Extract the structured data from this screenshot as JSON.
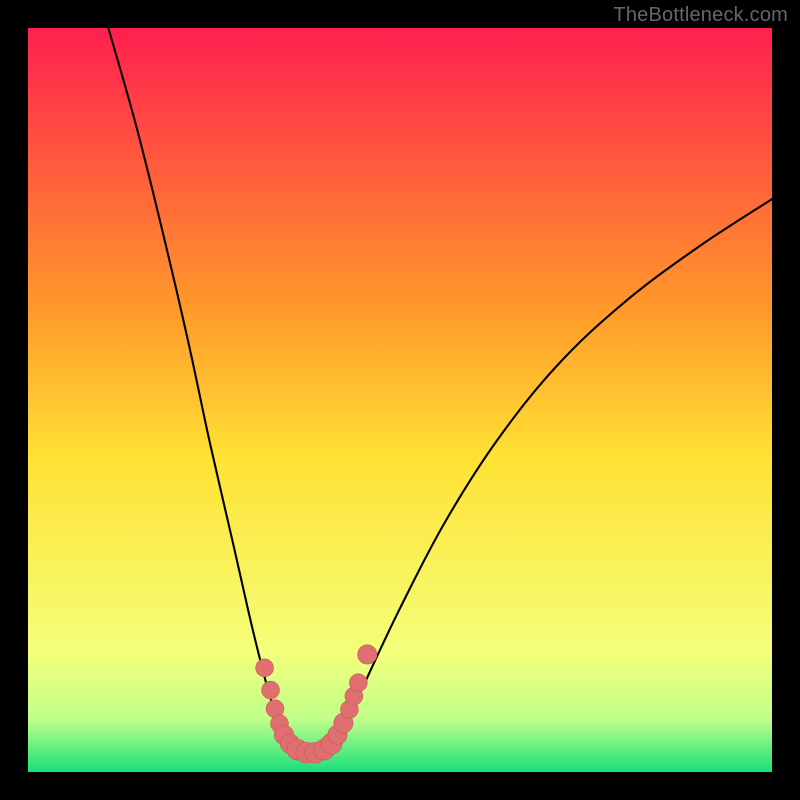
{
  "watermark": "TheBottleneck.com",
  "colors": {
    "frame": "#000000",
    "grad_top": "#ff1f4f",
    "grad_mid_high": "#ff9a2a",
    "grad_mid": "#ffe234",
    "grad_low": "#f4ff7a",
    "grad_band": "#bfff8a",
    "grad_bottom": "#18e07a",
    "curve": "#000000",
    "marker_fill": "#e06f6f",
    "marker_stroke": "#c85a5a"
  },
  "chart_data": {
    "type": "line",
    "title": "",
    "xlabel": "",
    "ylabel": "",
    "xlim": [
      0,
      100
    ],
    "ylim": [
      0,
      100
    ],
    "left_curve": {
      "x": [
        10.8,
        14.5,
        18.0,
        21.5,
        24.5,
        27.5,
        30.0,
        32.0,
        33.5,
        34.5,
        35.3
      ],
      "y": [
        100,
        87,
        73,
        58,
        44,
        31,
        20,
        12,
        7,
        4,
        2.5
      ]
    },
    "right_curve": {
      "x": [
        40.5,
        42.5,
        45.5,
        50.0,
        56.0,
        63.0,
        71.0,
        80.0,
        90.0,
        100.0
      ],
      "y": [
        2.6,
        6.0,
        12.5,
        22.0,
        33.5,
        44.5,
        54.5,
        63.0,
        70.5,
        77.0
      ]
    },
    "valley_floor": {
      "x": [
        35.3,
        36.5,
        37.8,
        39.0,
        40.5
      ],
      "y": [
        2.5,
        2.0,
        1.9,
        2.0,
        2.6
      ]
    },
    "markers": [
      {
        "x": 31.8,
        "y": 14.0,
        "r": 1.2
      },
      {
        "x": 32.6,
        "y": 11.0,
        "r": 1.2
      },
      {
        "x": 33.2,
        "y": 8.5,
        "r": 1.2
      },
      {
        "x": 33.8,
        "y": 6.5,
        "r": 1.2
      },
      {
        "x": 34.4,
        "y": 5.0,
        "r": 1.3
      },
      {
        "x": 35.2,
        "y": 3.8,
        "r": 1.3
      },
      {
        "x": 36.2,
        "y": 3.0,
        "r": 1.4
      },
      {
        "x": 37.4,
        "y": 2.6,
        "r": 1.4
      },
      {
        "x": 38.6,
        "y": 2.6,
        "r": 1.4
      },
      {
        "x": 39.8,
        "y": 3.0,
        "r": 1.4
      },
      {
        "x": 40.8,
        "y": 3.8,
        "r": 1.4
      },
      {
        "x": 41.6,
        "y": 5.0,
        "r": 1.3
      },
      {
        "x": 42.4,
        "y": 6.6,
        "r": 1.3
      },
      {
        "x": 43.2,
        "y": 8.4,
        "r": 1.2
      },
      {
        "x": 43.8,
        "y": 10.2,
        "r": 1.2
      },
      {
        "x": 44.4,
        "y": 12.0,
        "r": 1.2
      },
      {
        "x": 45.6,
        "y": 15.8,
        "r": 1.3
      }
    ]
  }
}
